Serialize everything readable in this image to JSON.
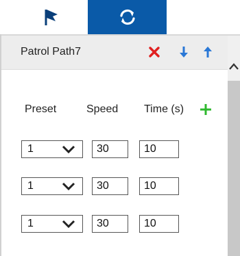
{
  "tabs": [
    {
      "name": "presets",
      "icon": "flag-icon",
      "active": false
    },
    {
      "name": "patrol",
      "icon": "refresh-icon",
      "active": true
    }
  ],
  "path": {
    "title": "Patrol Path7"
  },
  "columns": {
    "preset": "Preset",
    "speed": "Speed",
    "time": "Time (s)"
  },
  "rows": [
    {
      "preset": "1",
      "speed": "30",
      "time": "10"
    },
    {
      "preset": "1",
      "speed": "30",
      "time": "10"
    },
    {
      "preset": "1",
      "speed": "30",
      "time": "10"
    }
  ],
  "colors": {
    "active_tab": "#0a5aa8",
    "delete": "#e02020",
    "move": "#2a78d6",
    "add": "#2eb82e"
  }
}
